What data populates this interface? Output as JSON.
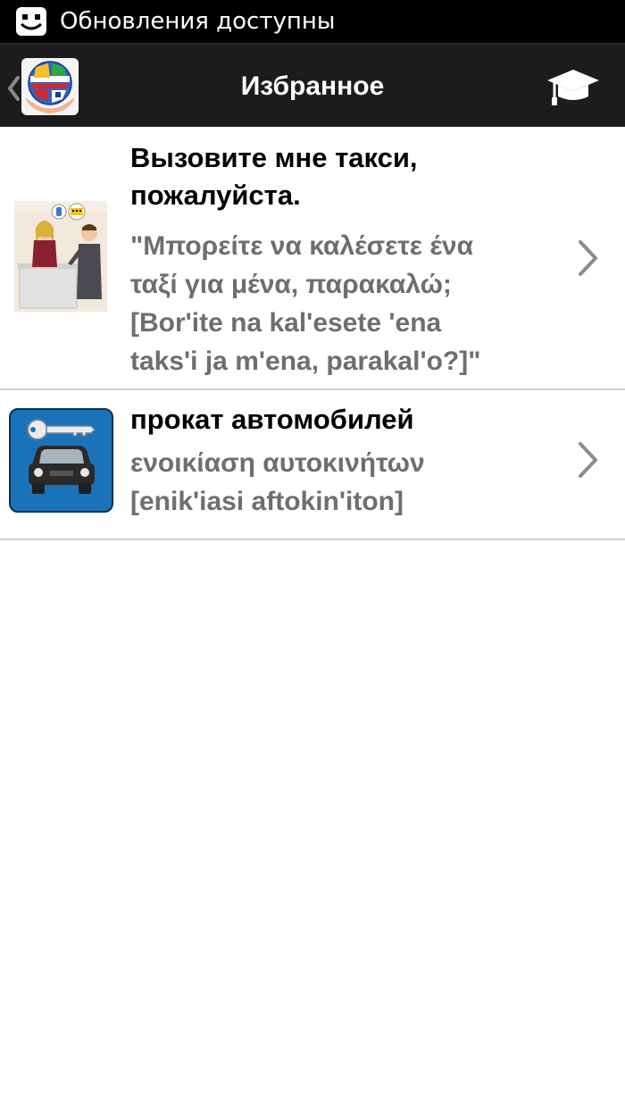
{
  "status_bar": {
    "notification_icon": "notification-face-icon",
    "text": "Обновления доступны"
  },
  "action_bar": {
    "back_icon": "chevron-left-icon",
    "logo_icon": "globe-flags-app-icon",
    "title": "Избранное",
    "learn_icon": "graduation-cap-icon"
  },
  "favorites": [
    {
      "thumb_icon": "taxi-reception-illustration",
      "title_lines": [
        "Вызовите мне такси,",
        "пожалуйста."
      ],
      "translation_lines": [
        "\"Μπορείτε να καλέσετε ένα",
        "ταξί  για μένα, παρακαλώ;",
        "[Bor'ite na kal'esete 'ena",
        "taks'i ja m'ena, parakal'o?]\""
      ],
      "chevron_icon": "chevron-right-icon"
    },
    {
      "thumb_icon": "car-rental-key-icon",
      "title_lines": [
        "прокат автомобилей"
      ],
      "translation_lines": [
        "ενοικίαση αυτοκινήτων",
        "[enik'iasi aftokin'iton]"
      ],
      "chevron_icon": "chevron-right-icon"
    }
  ],
  "colors": {
    "status_bar_bg": "#000000",
    "action_bar_bg": "#1c1c1c",
    "title_text": "#000000",
    "translation_text": "#6e6e6e",
    "divider": "#cfcfcf",
    "car_icon_bg": "#1a73b9"
  }
}
